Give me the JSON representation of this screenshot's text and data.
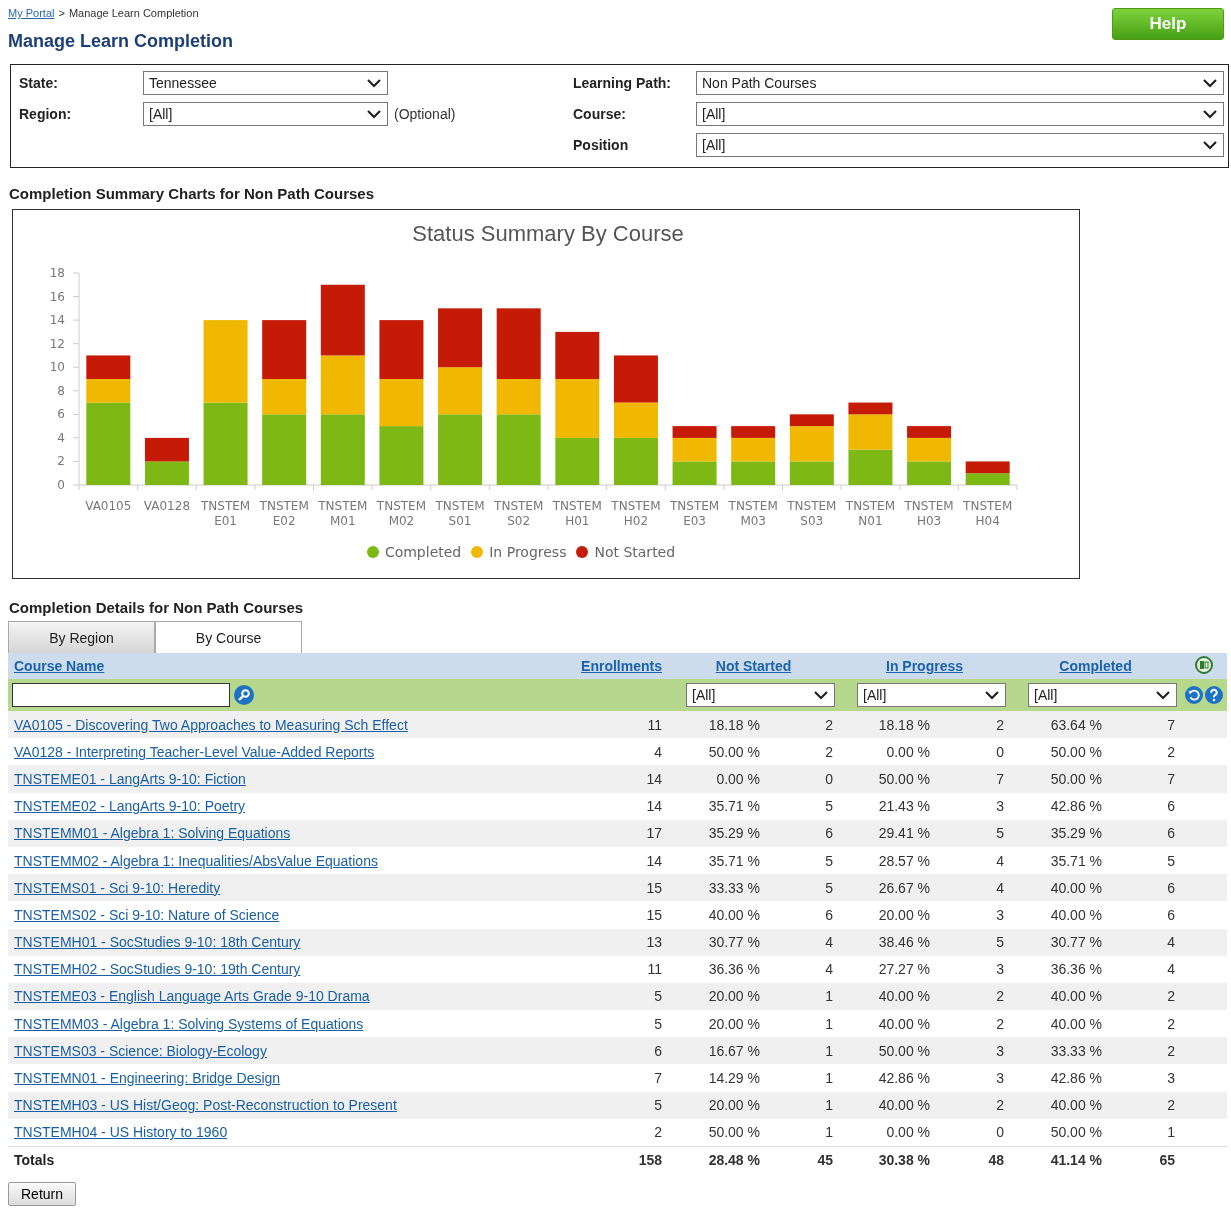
{
  "breadcrumb": {
    "link": "My Portal",
    "separator": ">",
    "current": "Manage Learn Completion"
  },
  "title": "Manage Learn Completion",
  "help_button": "Help",
  "filters": {
    "left": [
      {
        "label": "State:",
        "value": "Tennessee"
      },
      {
        "label": "Region:",
        "value": "[All]",
        "note": "(Optional)"
      }
    ],
    "right": [
      {
        "label": "Learning Path:",
        "value": "Non Path Courses"
      },
      {
        "label": "Course:",
        "value": "[All]"
      },
      {
        "label": "Position",
        "value": "[All]"
      }
    ]
  },
  "charts_heading": "Completion Summary Charts for Non Path Courses",
  "chart": {
    "chart_data": {
      "type": "bar",
      "title": "Status Summary By Course",
      "stacked": true,
      "legend": "bottom",
      "categories": [
        "VA0105",
        "VA0128",
        "TNSTEM E01",
        "TNSTEM E02",
        "TNSTEM M01",
        "TNSTEM M02",
        "TNSTEM S01",
        "TNSTEM S02",
        "TNSTEM H01",
        "TNSTEM H02",
        "TNSTEM E03",
        "TNSTEM M03",
        "TNSTEM S03",
        "TNSTEM N01",
        "TNSTEM H03",
        "TNSTEM H04"
      ],
      "series": [
        {
          "name": "Completed",
          "color": "#7db814",
          "values": [
            7,
            2,
            7,
            6,
            6,
            5,
            6,
            6,
            4,
            4,
            2,
            2,
            2,
            3,
            2,
            1
          ]
        },
        {
          "name": "In Progress",
          "color": "#f0b800",
          "values": [
            2,
            0,
            7,
            3,
            5,
            4,
            4,
            3,
            5,
            3,
            2,
            2,
            3,
            3,
            2,
            0
          ]
        },
        {
          "name": "Not Started",
          "color": "#c51a06",
          "values": [
            2,
            2,
            0,
            5,
            6,
            5,
            5,
            6,
            4,
            4,
            1,
            1,
            1,
            1,
            1,
            1
          ]
        }
      ],
      "ylim": [
        0,
        18
      ],
      "yticks": [
        0,
        2,
        4,
        6,
        8,
        10,
        12,
        14,
        16,
        18
      ]
    }
  },
  "details_heading": "Completion Details for Non Path Courses",
  "tabs": [
    {
      "label": "By Region",
      "selected": false
    },
    {
      "label": "By Course",
      "selected": true
    }
  ],
  "table": {
    "columns": [
      "Course Name",
      "Enrollments",
      "Not Started",
      "In Progress",
      "Completed"
    ],
    "status_filters": [
      "[All]",
      "[All]",
      "[All]"
    ],
    "rows": [
      [
        "VA0105 - Discovering Two Approaches to Measuring Sch Effect",
        "11",
        {
          "percent": "18.18 %",
          "count": "2"
        },
        {
          "percent": "18.18 %",
          "count": "2"
        },
        {
          "percent": "63.64 %",
          "count": "7"
        }
      ],
      [
        "VA0128 - Interpreting Teacher-Level Value-Added Reports",
        "4",
        {
          "percent": "50.00 %",
          "count": "2"
        },
        {
          "percent": "0.00 %",
          "count": "0"
        },
        {
          "percent": "50.00 %",
          "count": "2"
        }
      ],
      [
        "TNSTEME01 - LangArts 9-10: Fiction",
        "14",
        {
          "percent": "0.00 %",
          "count": "0"
        },
        {
          "percent": "50.00 %",
          "count": "7"
        },
        {
          "percent": "50.00 %",
          "count": "7"
        }
      ],
      [
        "TNSTEME02 - LangArts 9-10: Poetry",
        "14",
        {
          "percent": "35.71 %",
          "count": "5"
        },
        {
          "percent": "21.43 %",
          "count": "3"
        },
        {
          "percent": "42.86 %",
          "count": "6"
        }
      ],
      [
        "TNSTEMM01 - Algebra 1: Solving Equations",
        "17",
        {
          "percent": "35.29 %",
          "count": "6"
        },
        {
          "percent": "29.41 %",
          "count": "5"
        },
        {
          "percent": "35.29 %",
          "count": "6"
        }
      ],
      [
        "TNSTEMM02 - Algebra 1: Inequalities/AbsValue Equations",
        "14",
        {
          "percent": "35.71 %",
          "count": "5"
        },
        {
          "percent": "28.57 %",
          "count": "4"
        },
        {
          "percent": "35.71 %",
          "count": "5"
        }
      ],
      [
        "TNSTEMS01 - Sci 9-10: Heredity",
        "15",
        {
          "percent": "33.33 %",
          "count": "5"
        },
        {
          "percent": "26.67 %",
          "count": "4"
        },
        {
          "percent": "40.00 %",
          "count": "6"
        }
      ],
      [
        "TNSTEMS02 - Sci 9-10: Nature of Science",
        "15",
        {
          "percent": "40.00 %",
          "count": "6"
        },
        {
          "percent": "20.00 %",
          "count": "3"
        },
        {
          "percent": "40.00 %",
          "count": "6"
        }
      ],
      [
        "TNSTEMH01 - SocStudies 9-10: 18th Century",
        "13",
        {
          "percent": "30.77 %",
          "count": "4"
        },
        {
          "percent": "38.46 %",
          "count": "5"
        },
        {
          "percent": "30.77 %",
          "count": "4"
        }
      ],
      [
        "TNSTEMH02 - SocStudies 9-10: 19th Century",
        "11",
        {
          "percent": "36.36 %",
          "count": "4"
        },
        {
          "percent": "27.27 %",
          "count": "3"
        },
        {
          "percent": "36.36 %",
          "count": "4"
        }
      ],
      [
        "TNSTEME03 - English Language Arts Grade 9-10 Drama",
        "5",
        {
          "percent": "20.00 %",
          "count": "1"
        },
        {
          "percent": "40.00 %",
          "count": "2"
        },
        {
          "percent": "40.00 %",
          "count": "2"
        }
      ],
      [
        "TNSTEMM03 - Algebra 1: Solving Systems of Equations",
        "5",
        {
          "percent": "20.00 %",
          "count": "1"
        },
        {
          "percent": "40.00 %",
          "count": "2"
        },
        {
          "percent": "40.00 %",
          "count": "2"
        }
      ],
      [
        "TNSTEMS03 - Science: Biology-Ecology",
        "6",
        {
          "percent": "16.67 %",
          "count": "1"
        },
        {
          "percent": "50.00 %",
          "count": "3"
        },
        {
          "percent": "33.33 %",
          "count": "2"
        }
      ],
      [
        "TNSTEMN01 - Engineering: Bridge Design",
        "7",
        {
          "percent": "14.29 %",
          "count": "1"
        },
        {
          "percent": "42.86 %",
          "count": "3"
        },
        {
          "percent": "42.86 %",
          "count": "3"
        }
      ],
      [
        "TNSTEMH03 - US Hist/Geog: Post-Reconstruction to Present",
        "5",
        {
          "percent": "20.00 %",
          "count": "1"
        },
        {
          "percent": "40.00 %",
          "count": "2"
        },
        {
          "percent": "40.00 %",
          "count": "2"
        }
      ],
      [
        "TNSTEMH04 - US History to 1960",
        "2",
        {
          "percent": "50.00 %",
          "count": "1"
        },
        {
          "percent": "0.00 %",
          "count": "0"
        },
        {
          "percent": "50.00 %",
          "count": "1"
        }
      ]
    ],
    "totals": [
      "Totals",
      "158",
      {
        "percent": "28.48 %",
        "count": "45"
      },
      {
        "percent": "30.38 %",
        "count": "48"
      },
      {
        "percent": "41.14 %",
        "count": "65"
      }
    ]
  },
  "return_button": "Return"
}
